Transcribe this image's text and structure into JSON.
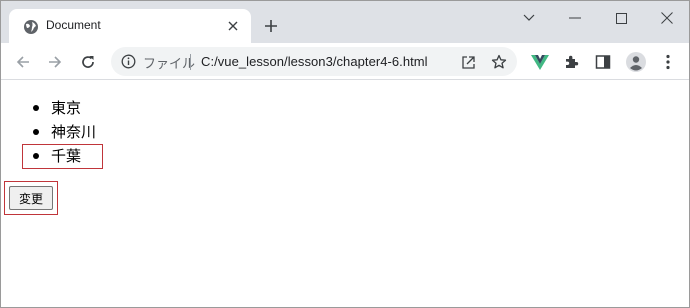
{
  "tab": {
    "title": "Document"
  },
  "omnibox": {
    "scheme_label": "ファイル",
    "url": "C:/vue_lesson/lesson3/chapter4-6.html"
  },
  "page": {
    "prefectures": [
      "東京",
      "神奈川",
      "千葉"
    ],
    "change_button": "変更"
  },
  "colors": {
    "tabstrip": "#dee1e6",
    "omnibox": "#f1f3f4",
    "highlight_border": "#c0353a",
    "vue_green": "#41b883",
    "vue_dark": "#34495e"
  },
  "icons": [
    "globe-icon",
    "close-icon",
    "plus-icon",
    "chevron-down-icon",
    "minimize-icon",
    "maximize-icon",
    "close-window-icon",
    "back-arrow-icon",
    "forward-arrow-icon",
    "reload-icon",
    "info-icon",
    "share-icon",
    "star-icon",
    "vue-devtools-icon",
    "extensions-puzzle-icon",
    "side-panel-icon",
    "profile-avatar-icon",
    "more-vert-icon"
  ]
}
